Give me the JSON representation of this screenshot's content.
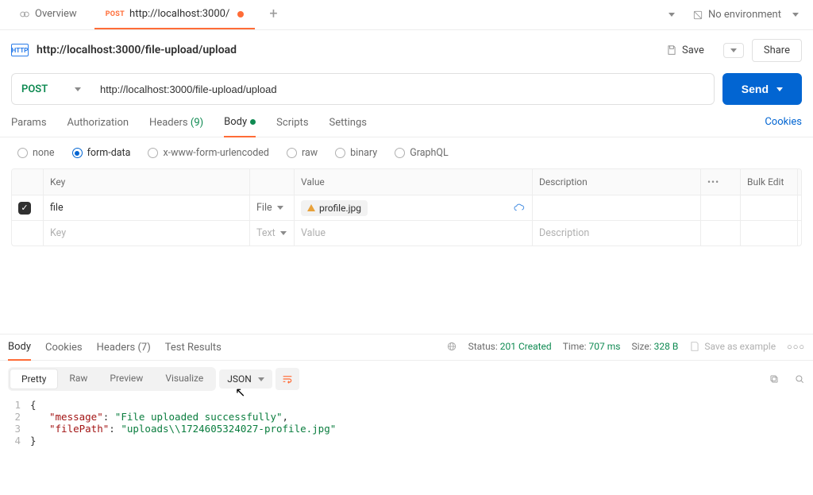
{
  "tabs": {
    "overview": "Overview",
    "req": {
      "method": "POST",
      "label": "http://localhost:3000/"
    }
  },
  "environment": {
    "label": "No environment"
  },
  "header": {
    "url_title": "http://localhost:3000/file-upload/upload",
    "save": "Save",
    "share": "Share"
  },
  "request": {
    "method": "POST",
    "url": "http://localhost:3000/file-upload/upload",
    "send": "Send"
  },
  "reqTabs": {
    "params": "Params",
    "authorization": "Authorization",
    "headers": "Headers",
    "headers_count": "(9)",
    "body": "Body",
    "scripts": "Scripts",
    "settings": "Settings",
    "cookies": "Cookies"
  },
  "bodyTypes": {
    "none": "none",
    "formdata": "form-data",
    "xwww": "x-www-form-urlencoded",
    "raw": "raw",
    "binary": "binary",
    "graphql": "GraphQL"
  },
  "kv": {
    "head_key": "Key",
    "head_value": "Value",
    "head_desc": "Description",
    "bulk_edit": "Bulk Edit",
    "row1_key": "file",
    "row1_typelabel": "File",
    "row1_filename": "profile.jpg",
    "ghost_key": "Key",
    "ghost_type": "Text",
    "ghost_value": "Value",
    "ghost_desc": "Description"
  },
  "respTabs": {
    "body": "Body",
    "cookies": "Cookies",
    "headers": "Headers",
    "headers_count": "(7)",
    "test": "Test Results"
  },
  "respMeta": {
    "status_label": "Status:",
    "status_value": "201 Created",
    "time_label": "Time:",
    "time_value": "707 ms",
    "size_label": "Size:",
    "size_value": "328 B",
    "save_example": "Save as example"
  },
  "respView": {
    "pretty": "Pretty",
    "raw": "Raw",
    "preview": "Preview",
    "visualize": "Visualize",
    "format": "JSON"
  },
  "responseBody": {
    "l1": "{",
    "l2_key": "\"message\"",
    "l2_val": "\"File uploaded successfully\"",
    "l3_key": "\"filePath\"",
    "l3_val": "\"uploads\\\\1724605324027-profile.jpg\"",
    "l4": "}"
  }
}
